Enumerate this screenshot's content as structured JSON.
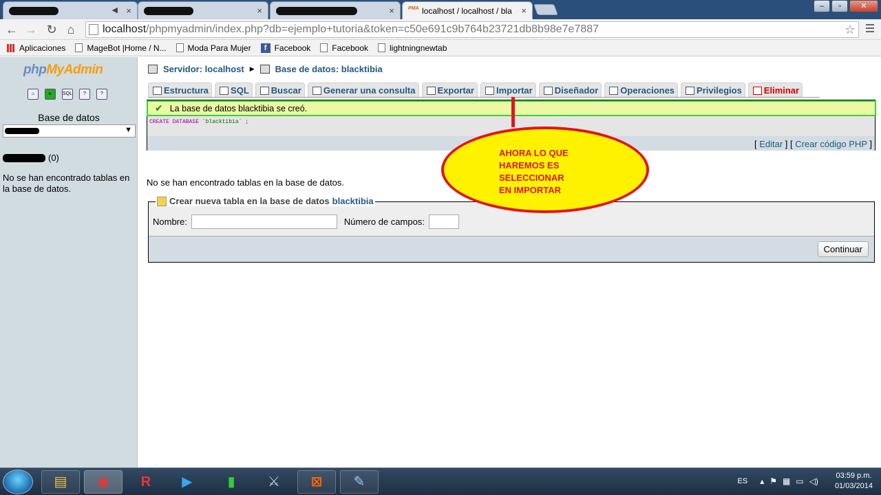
{
  "browser": {
    "tabs": [
      {
        "title": "",
        "redacted": true
      },
      {
        "title": "",
        "redacted": true
      },
      {
        "title": "",
        "redacted": true
      },
      {
        "title": "localhost / localhost / bla",
        "active": true
      }
    ],
    "url_host": "localhost",
    "url_path": "/phpmyadmin/index.php?db=ejemplo+tutoria&token=c50e691c9b764b23721db8b98e7e7887",
    "bookmarks": [
      "Aplicaciones",
      "MageBot |Home / N...",
      "Moda Para Mujer",
      "Facebook",
      "Facebook",
      "lightningnewtab"
    ]
  },
  "sidebar": {
    "logo_php": "php",
    "logo_myadmin": "MyAdmin",
    "db_label": "Base de datos",
    "db_count": "(0)",
    "no_tables": "No se han encontrado tablas en la base de datos."
  },
  "breadcrumb": {
    "server": "Servidor: localhost",
    "database": "Base de datos: blacktibia"
  },
  "tabs": [
    {
      "label": "Estructura",
      "icon": "structure-icon"
    },
    {
      "label": "SQL",
      "icon": "sql-icon"
    },
    {
      "label": "Buscar",
      "icon": "search-icon"
    },
    {
      "label": "Generar una consulta",
      "icon": "query-icon"
    },
    {
      "label": "Exportar",
      "icon": "export-icon"
    },
    {
      "label": "Importar",
      "icon": "import-icon"
    },
    {
      "label": "Diseñador",
      "icon": "designer-icon"
    },
    {
      "label": "Operaciones",
      "icon": "operations-icon"
    },
    {
      "label": "Privilegios",
      "icon": "privileges-icon"
    },
    {
      "label": "Eliminar",
      "icon": "drop-icon"
    }
  ],
  "message": {
    "success": "La base de datos blacktibia se creó.",
    "sql_keyword": "CREATE DATABASE",
    "sql_name": "`blacktibia`",
    "sql_end": ";",
    "edit_link": "Editar",
    "php_link": "Crear código PHP"
  },
  "main": {
    "no_tables": "No se han encontrado tablas en la base de datos."
  },
  "create_table": {
    "legend": "Crear nueva tabla en la base de datos",
    "db": "blacktibia",
    "name_label": "Nombre:",
    "fields_label": "Número de campos:",
    "submit": "Continuar"
  },
  "annotation": {
    "text": "AHORA LO QUE\nHAREMOS ES\nSELECCIONAR\nEN IMPORTAR",
    "color": "#e0161b",
    "fill": "#fef200"
  },
  "taskbar": {
    "lang": "ES",
    "time": "03:59 p.m.",
    "date": "01/03/2014"
  }
}
